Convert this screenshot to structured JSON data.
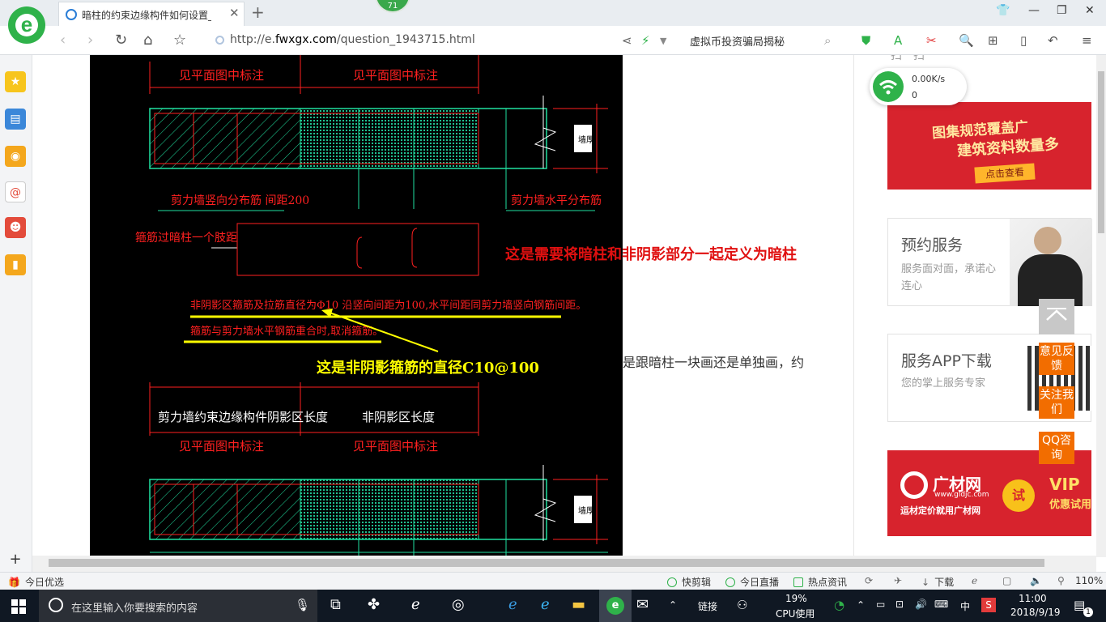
{
  "browser": {
    "tab_title": "暗柱的约束边缘构件如何设置_广",
    "tab_close": "✕",
    "new_tab": "+",
    "badge_count": "71",
    "url": "http://e.fwxgx.com/question_1943715.html",
    "url_domain_prefix": "http://e.",
    "url_domain": "fwxgx.com",
    "url_path": "/question_1943715.html",
    "search_hint": "虚拟币投资骗局揭秘",
    "zoom": "110%"
  },
  "cad": {
    "top_labels": [
      "见平面图中标注",
      "见平面图中标注"
    ],
    "wall_vertical_note": "剪力墙竖向分布筋  间距200",
    "wall_horizontal_note": "剪力墙水平分布筋",
    "stirrup_note": "箍筋过暗柱一个肢距",
    "red_note_line1": "非阴影区箍筋及拉筋直径为Φ10 沿竖向间距为100,水平间距同剪力墙竖向钢筋间距。",
    "red_note_line2": "箍筋与剪力墙水平钢筋重合时,取消箍筋。",
    "red_annotation": "这是需要将暗柱和非阴影部分一起定义为暗柱",
    "yellow_annotation": "这是非阴影箍筋的直径C10@100",
    "lower_labels": [
      "剪力墙约束边缘构件阴影区长度",
      "非阴影区长度"
    ],
    "lower_sub_labels": [
      "见平面图中标注",
      "见平面图中标注"
    ],
    "wall_tag": "墙厚"
  },
  "question_text": "是跟暗柱一块画还是单独画，约",
  "right_panel": {
    "top_text": "扫一扫",
    "banner1": {
      "line1": "图集规范覆盖广",
      "line2": "建筑资料数量多",
      "button": "点击查看"
    },
    "card1": {
      "title": "预约服务",
      "subtitle": "服务面对面，承诺心连心"
    },
    "card2": {
      "title": "服务APP下载",
      "subtitle": "您的掌上服务专家"
    },
    "banner2": {
      "name": "广材网",
      "domain": "www.gldjc.com",
      "slogan": "运材定价就用广材网",
      "try": "试",
      "vip": "VIP",
      "vip_sub": "优惠试用"
    }
  },
  "speed_widget": {
    "upload": "0.00K/s",
    "download": "0"
  },
  "float_buttons": [
    "意见反馈",
    "关注我们",
    "QQ咨询"
  ],
  "status_bar": {
    "left": "今日优选",
    "items": [
      "快剪辑",
      "今日直播",
      "热点资讯",
      "下载"
    ],
    "zoom": "110%"
  },
  "taskbar": {
    "search_placeholder": "在这里输入你要搜索的内容",
    "links": "链接",
    "cpu_percent": "19%",
    "cpu_label": "CPU使用",
    "ime": "中",
    "time": "11:00",
    "date": "2018/9/19",
    "notify_count": "1"
  },
  "colors": {
    "cad_bg": "#000000",
    "cad_red": "#ff2020",
    "cad_green": "#20e0a0",
    "cad_yellow": "#ffff00",
    "brand_green": "#2fb24a",
    "orange": "#f26d00",
    "banner_red": "#d7232d"
  }
}
